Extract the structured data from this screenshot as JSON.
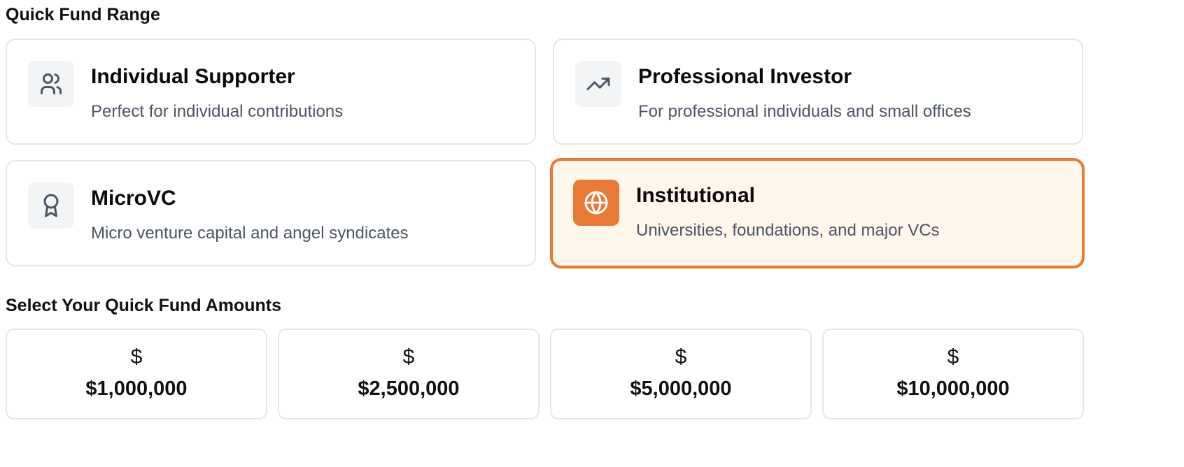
{
  "quick_fund_range": {
    "title": "Quick Fund Range",
    "options": [
      {
        "title": "Individual Supporter",
        "description": "Perfect for individual contributions",
        "icon": "users-icon",
        "selected": false
      },
      {
        "title": "Professional Investor",
        "description": "For professional individuals and small offices",
        "icon": "trending-up-icon",
        "selected": false
      },
      {
        "title": "MicroVC",
        "description": "Micro venture capital and angel syndicates",
        "icon": "award-icon",
        "selected": false
      },
      {
        "title": "Institutional",
        "description": "Universities, foundations, and major VCs",
        "icon": "globe-icon",
        "selected": true
      }
    ]
  },
  "quick_fund_amounts": {
    "title": "Select Your Quick Fund Amounts",
    "amounts": [
      {
        "symbol": "$",
        "value": "$1,000,000"
      },
      {
        "symbol": "$",
        "value": "$2,500,000"
      },
      {
        "symbol": "$",
        "value": "$5,000,000"
      },
      {
        "symbol": "$",
        "value": "$10,000,000"
      }
    ]
  },
  "colors": {
    "accent": "#e87a35",
    "selected_background": "#fff6ec",
    "card_border": "#e5e7eb",
    "icon_background": "#f3f4f6",
    "muted_text": "#4b5563"
  }
}
